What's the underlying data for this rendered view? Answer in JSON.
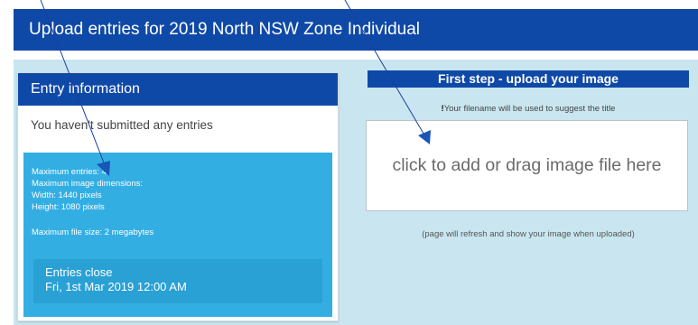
{
  "header": {
    "title": "Upload entries for 2019 North NSW Zone Individual"
  },
  "entry_panel": {
    "title": "Entry information",
    "status": "You haven't submitted any entries",
    "limits": {
      "max_entries": "Maximum entries: 4",
      "max_dimensions": "Maximum image dimensions:",
      "width": "Width: 1440 pixels",
      "height": "Height: 1080 pixels",
      "max_file_size": "Maximum file size: 2 megabytes"
    },
    "close": {
      "label": "Entries close",
      "date": "Fri, 1st Mar 2019 12:00 AM"
    }
  },
  "upload_panel": {
    "title": "First step - upload your image",
    "filename_note_mark": "!",
    "filename_note": "Your filename will be used to suggest the title",
    "dropzone_text": "click to add or drag image file here",
    "refresh_note": "(page will refresh and show your image when uploaded)"
  },
  "colors": {
    "primary": "#0f49a8",
    "info_box": "#33aee3",
    "content_bg": "#c9e6f0"
  }
}
